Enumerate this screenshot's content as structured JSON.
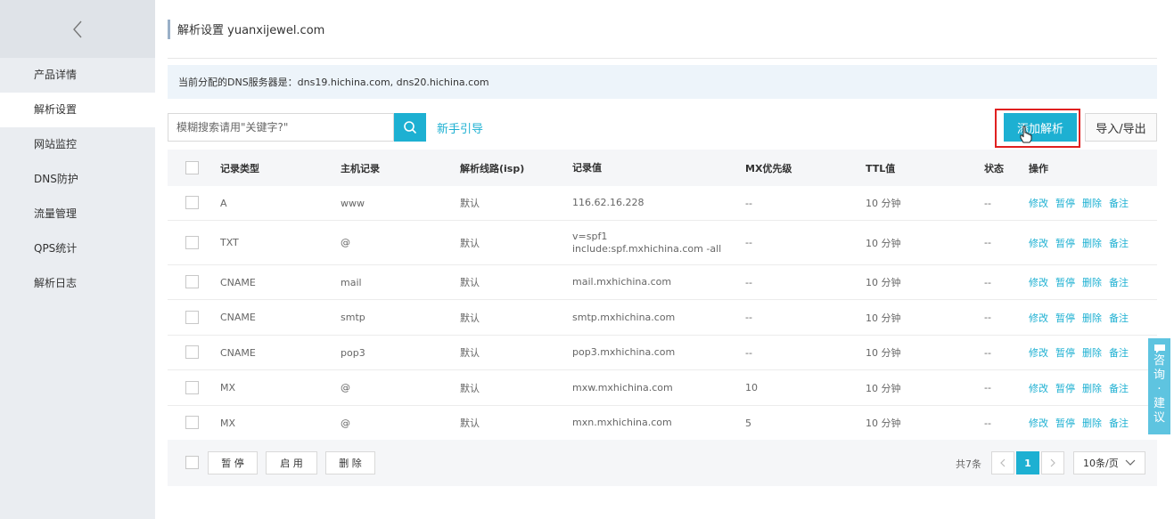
{
  "sidebar": {
    "items": [
      {
        "label": "产品详情"
      },
      {
        "label": "解析设置"
      },
      {
        "label": "网站监控"
      },
      {
        "label": "DNS防护"
      },
      {
        "label": "流量管理"
      },
      {
        "label": "QPS统计"
      },
      {
        "label": "解析日志"
      }
    ]
  },
  "header": {
    "title": "解析设置 yuanxijewel.com"
  },
  "dns_info": "当前分配的DNS服务器是：dns19.hichina.com, dns20.hichina.com",
  "toolbar": {
    "search_placeholder": "模糊搜索请用\"关键字?\"",
    "guide_label": "新手引导",
    "add_label": "添加解析",
    "export_label": "导入/导出"
  },
  "table": {
    "columns": [
      "记录类型",
      "主机记录",
      "解析线路(isp)",
      "记录值",
      "MX优先级",
      "TTL值",
      "状态",
      "操作"
    ],
    "ops": [
      "修改",
      "暂停",
      "删除",
      "备注"
    ],
    "rows": [
      {
        "type": "A",
        "host": "www",
        "line": "默认",
        "value": "116.62.16.228",
        "mx": "--",
        "ttl": "10 分钟",
        "status": "--"
      },
      {
        "type": "TXT",
        "host": "@",
        "line": "默认",
        "value": "v=spf1 include:spf.mxhichina.com -all",
        "mx": "--",
        "ttl": "10 分钟",
        "status": "--"
      },
      {
        "type": "CNAME",
        "host": "mail",
        "line": "默认",
        "value": "mail.mxhichina.com",
        "mx": "--",
        "ttl": "10 分钟",
        "status": "--"
      },
      {
        "type": "CNAME",
        "host": "smtp",
        "line": "默认",
        "value": "smtp.mxhichina.com",
        "mx": "--",
        "ttl": "10 分钟",
        "status": "--"
      },
      {
        "type": "CNAME",
        "host": "pop3",
        "line": "默认",
        "value": "pop3.mxhichina.com",
        "mx": "--",
        "ttl": "10 分钟",
        "status": "--"
      },
      {
        "type": "MX",
        "host": "@",
        "line": "默认",
        "value": "mxw.mxhichina.com",
        "mx": "10",
        "ttl": "10 分钟",
        "status": "--"
      },
      {
        "type": "MX",
        "host": "@",
        "line": "默认",
        "value": "mxn.mxhichina.com",
        "mx": "5",
        "ttl": "10 分钟",
        "status": "--"
      }
    ]
  },
  "footer": {
    "pause_label": "暂 停",
    "enable_label": "启 用",
    "delete_label": "删 除",
    "total_text": "共7条",
    "current_page": "1",
    "page_size": "10条/页"
  },
  "feedback": {
    "label": "咨询·建议"
  },
  "colors": {
    "accent": "#1db0d2",
    "highlight": "#e02020"
  }
}
